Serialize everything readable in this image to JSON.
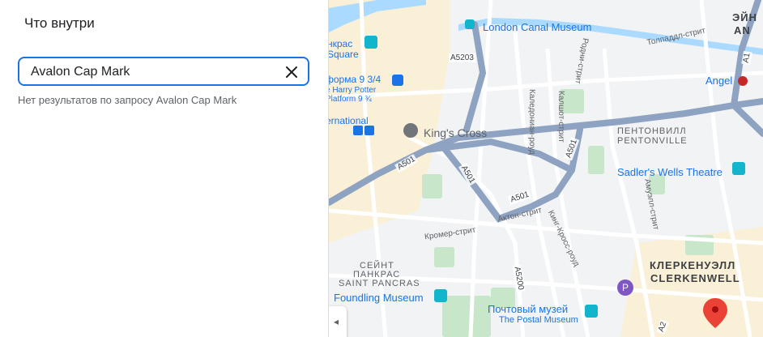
{
  "panel": {
    "title": "Что внутри",
    "search_value": "Avalon Cap Mark",
    "no_results": "Нет результатов по запросу Avalon Cap Mark"
  },
  "map": {
    "pois": {
      "london_canal_museum": "London Canal Museum",
      "kings_cross": "King's Cross",
      "sadlers_wells": "Sadler's Wells Theatre",
      "angel": "Angel",
      "foundling_museum": "Foundling Museum",
      "postal_museum_ru": "Почтовый музей",
      "postal_museum_en": "The Postal Museum",
      "platform_ru": "форма 9 3/4",
      "platform_en1": "e Harry Potter",
      "platform_en2": "Platform 9 ¾",
      "pancras_ru": "нкрас",
      "square": "Square",
      "national": "ernational"
    },
    "districts": {
      "pentonville_ru": "ПЕНТОНВИЛЛ",
      "pentonville_en": "PENTONVILLE",
      "clerkenwell_ru": "КЛЕРКЕНУЭЛЛ",
      "clerkenwell_en": "CLERKENWELL",
      "st_pancras_ru1": "СЕЙНТ",
      "st_pancras_ru2": "ПАНКРАС",
      "st_pancras_en": "SAINT PANCRAS",
      "islington_ru": "ЭЙН",
      "islington_en": "AN"
    },
    "streets": {
      "tolpuddle": "Толпаддл-стрит",
      "caledonian": "Каледониан-роуд",
      "kalshot": "Калшот-стрит",
      "rodney": "Родни-стрит",
      "amwell": "Амуэлл-стрит",
      "cromer": "Кромер-стрит",
      "acton": "Актон-стрит",
      "kings_cross_road": "Кинг-Кросс-роуд"
    },
    "roads": {
      "a5203": "A5203",
      "a501_1": "A501",
      "a501_2": "A501",
      "a501_3": "A501",
      "a501_4": "A501",
      "a5200": "A5200",
      "a1": "A1",
      "a2": "A2"
    },
    "colors": {
      "background": "#f1f3f4",
      "major_road": "#8ea3c2",
      "water": "#aadaff",
      "park": "#c8e6c9",
      "highlight_area": "#faf0d8",
      "accent": "#1a73e8",
      "marker": "#ea4335"
    }
  }
}
